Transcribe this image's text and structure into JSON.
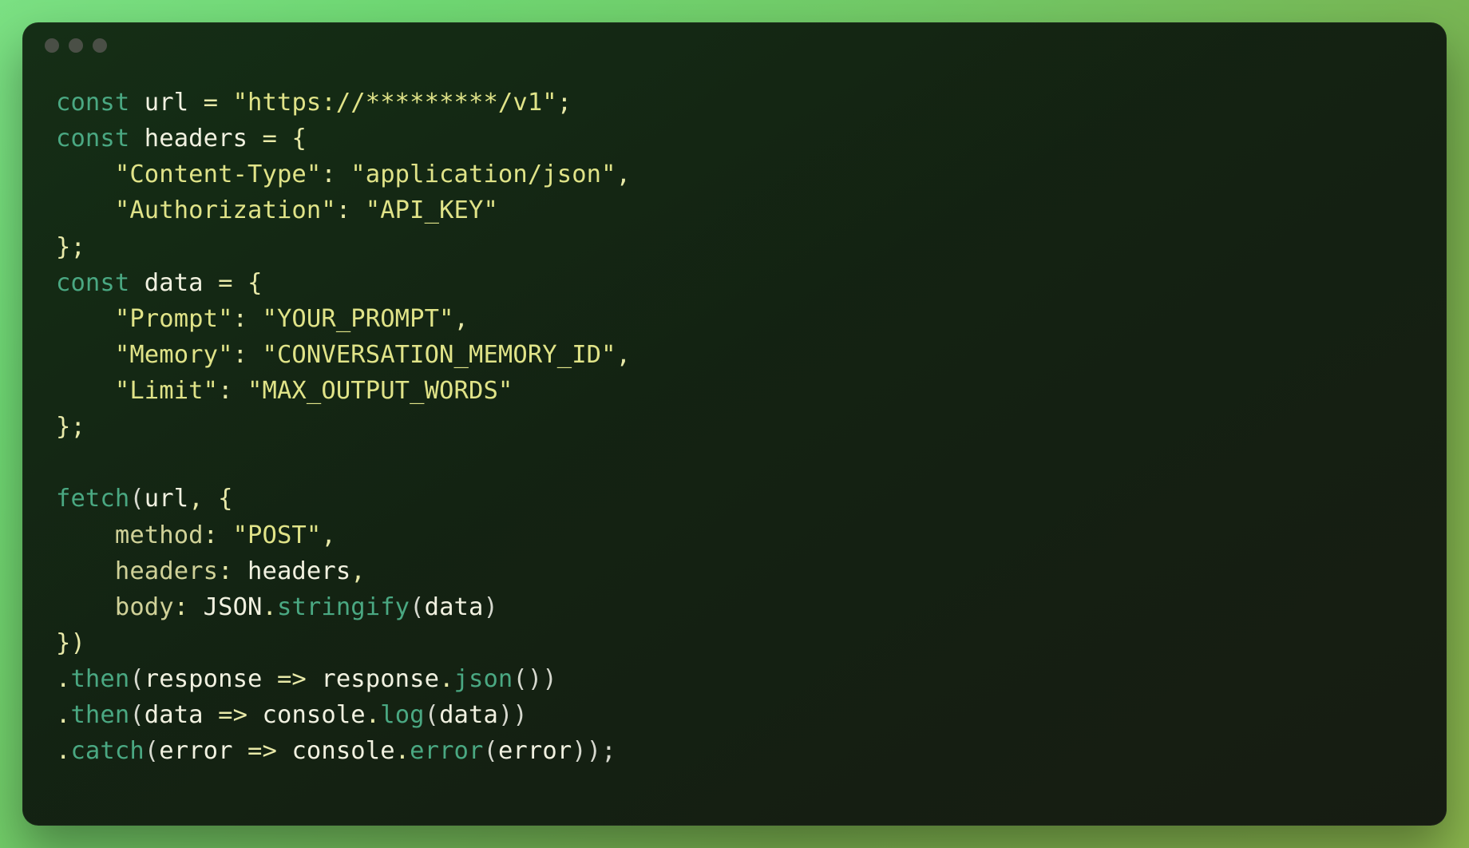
{
  "lines": {
    "l1": {
      "kw": "const",
      "id": "url",
      "eq": "=",
      "str": "\"https://*********/v1\"",
      "semi": ";"
    },
    "l2": {
      "kw": "const",
      "id": "headers",
      "eq": "=",
      "brace": "{"
    },
    "l3": {
      "key": "\"Content-Type\"",
      "colon": ":",
      "val": "\"application/json\"",
      "comma": ","
    },
    "l4": {
      "key": "\"Authorization\"",
      "colon": ":",
      "val": "\"API_KEY\""
    },
    "l5": {
      "close": "};"
    },
    "l6": {
      "kw": "const",
      "id": "data",
      "eq": "=",
      "brace": "{"
    },
    "l7": {
      "key": "\"Prompt\"",
      "colon": ":",
      "val": "\"YOUR_PROMPT\"",
      "comma": ","
    },
    "l8": {
      "key": "\"Memory\"",
      "colon": ":",
      "val": "\"CONVERSATION_MEMORY_ID\"",
      "comma": ","
    },
    "l9": {
      "key": "\"Limit\"",
      "colon": ":",
      "val": "\"MAX_OUTPUT_WORDS\""
    },
    "l10": {
      "close": "};"
    },
    "l11": {
      "fn": "fetch",
      "open": "(",
      "arg": "url",
      "comma": ", ",
      "brace": "{"
    },
    "l12": {
      "key": "method",
      "colon": ": ",
      "val": "\"POST\"",
      "comma": ","
    },
    "l13": {
      "key": "headers",
      "colon": ": ",
      "val": "headers",
      "comma": ","
    },
    "l14": {
      "key": "body",
      "colon": ": ",
      "j": "JSON",
      "dot1": ".",
      "s": "stringify",
      "open": "(",
      "arg": "data",
      "close": ")"
    },
    "l15": {
      "close": "})"
    },
    "l16": {
      "dot": ".",
      "fn": "then",
      "open": "(",
      "p": "response",
      "arrow": " => ",
      "p2": "response",
      "dot2": ".",
      "m": "json",
      "call": "()",
      "close": ")"
    },
    "l17": {
      "dot": ".",
      "fn": "then",
      "open": "(",
      "p": "data",
      "arrow": " => ",
      "c": "console",
      "dot2": ".",
      "m": "log",
      "call_open": "(",
      "arg": "data",
      "call_close": ")",
      "close": ")"
    },
    "l18": {
      "dot": ".",
      "fn": "catch",
      "open": "(",
      "p": "error",
      "arrow": " => ",
      "c": "console",
      "dot2": ".",
      "m": "error",
      "call_open": "(",
      "arg": "error",
      "call_close": ")",
      "close": ");"
    }
  }
}
